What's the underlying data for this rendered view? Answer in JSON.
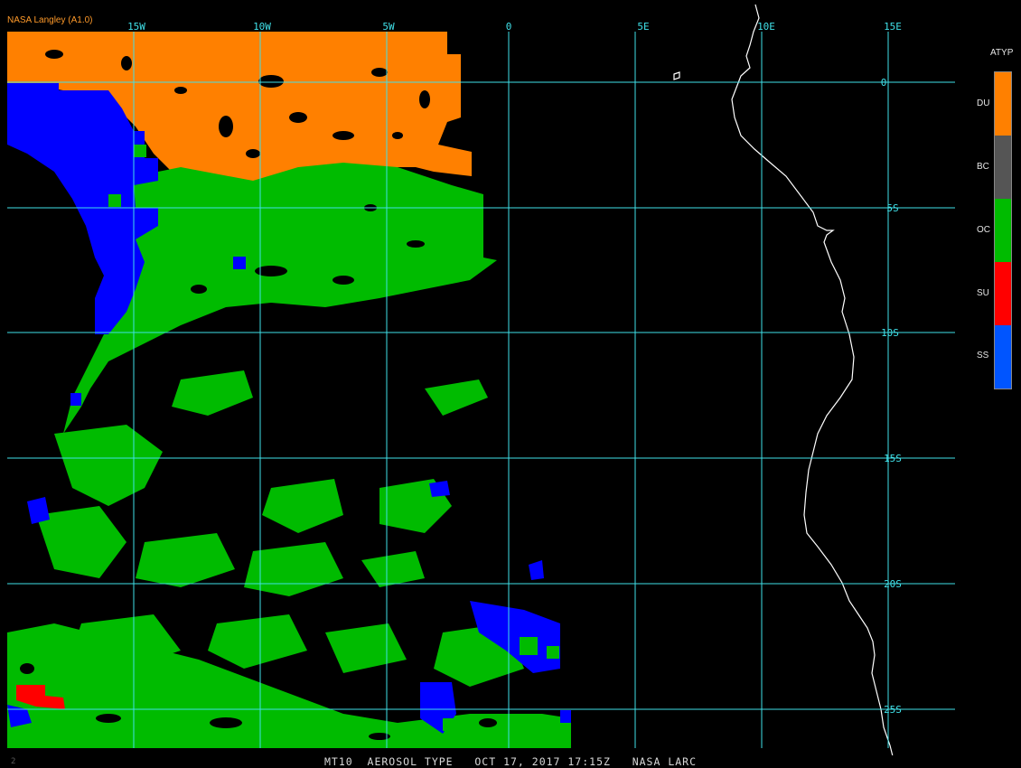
{
  "header": {
    "credit": "NASA Langley (A1.0)"
  },
  "footer": {
    "title": "MT10  AEROSOL TYPE   OCT 17, 2017 17:15Z   NASA LARC",
    "frame": "2"
  },
  "grid": {
    "lon_labels": [
      "15W",
      "10W",
      "5W",
      "0",
      "5E",
      "10E",
      "15E"
    ],
    "lat_labels": [
      "0",
      "5S",
      "10S",
      "15S",
      "20S",
      "25S"
    ]
  },
  "legend": {
    "title": "ATYP",
    "items": [
      {
        "code": "DU",
        "color": "#ff8000"
      },
      {
        "code": "BC",
        "color": "#555555"
      },
      {
        "code": "OC",
        "color": "#00bb00"
      },
      {
        "code": "SU",
        "color": "#ff0000"
      },
      {
        "code": "SS",
        "color": "#0055ff"
      }
    ]
  },
  "colors": {
    "grid": "#40e0e8",
    "coastline": "#ffffff",
    "dust": "#ff8000",
    "organic_carbon": "#00bb00",
    "sulfate": "#ff0000",
    "sea_salt": "#0000ff"
  }
}
